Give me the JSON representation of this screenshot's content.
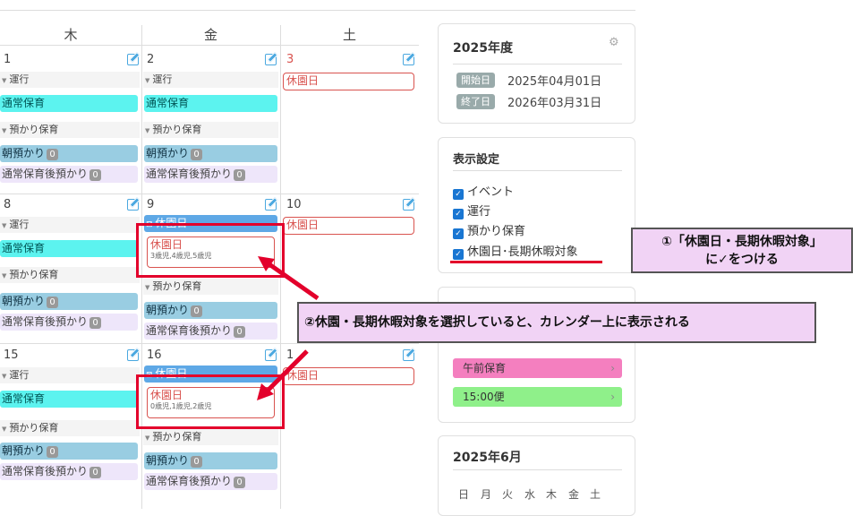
{
  "weekday_headers": [
    "木",
    "金",
    "土"
  ],
  "row1": {
    "thu": {
      "day": "1",
      "sections": {
        "unkou": "運行",
        "azukari": "預かり保育"
      },
      "chips": {
        "tsujo": "通常保育",
        "asa": "朝預かり",
        "asa_count": "0",
        "after": "通常保育後預かり",
        "after_count": "0"
      }
    },
    "fri": {
      "day": "2",
      "sections": {
        "unkou": "運行",
        "azukari": "預かり保育"
      },
      "chips": {
        "tsujo": "通常保育",
        "asa": "朝預かり",
        "asa_count": "0",
        "after": "通常保育後預かり",
        "after_count": "0"
      }
    },
    "sat": {
      "day": "3",
      "holiday": "休園日"
    }
  },
  "row2": {
    "thu": {
      "day": "8",
      "sections": {
        "unkou": "運行",
        "azukari": "預かり保育"
      },
      "chips": {
        "tsujo": "通常保育",
        "asa": "朝預かり",
        "asa_count": "0",
        "after": "通常保育後預かり",
        "after_count": "0"
      }
    },
    "fri": {
      "day": "9",
      "holiday_event": "休園日",
      "holiday": "休園日",
      "holiday_sub": "3歳児,4歳児,5歳児",
      "sections": {
        "azukari": "預かり保育"
      },
      "chips": {
        "asa": "朝預かり",
        "asa_count": "0",
        "after": "通常保育後預かり",
        "after_count": "0"
      }
    },
    "sat": {
      "day": "10",
      "holiday": "休園日"
    }
  },
  "row3": {
    "thu": {
      "day": "15",
      "sections": {
        "unkou": "運行",
        "azukari": "預かり保育"
      },
      "chips": {
        "tsujo": "通常保育",
        "asa": "朝預かり",
        "asa_count": "0",
        "after": "通常保育後預かり",
        "after_count": "0"
      }
    },
    "fri": {
      "day": "16",
      "holiday_event": "休園日",
      "holiday": "休園日",
      "holiday_sub": "0歳児,1歳児,2歳児",
      "sections": {
        "azukari": "預かり保育"
      },
      "chips": {
        "asa": "朝預かり",
        "asa_count": "0",
        "after": "通常保育後預かり",
        "after_count": "0"
      }
    },
    "sat": {
      "day": "1",
      "holiday": "休園日"
    }
  },
  "fiscal": {
    "title": "2025年度",
    "start_label": "開始日",
    "start_date": "2025年04月01日",
    "end_label": "終了日",
    "end_date": "2026年03月31日"
  },
  "display_settings": {
    "title": "表示設定",
    "options": [
      "イベント",
      "運行",
      "預かり保育",
      "休園日･長期休暇対象"
    ]
  },
  "routes": [
    {
      "label": "午前保育",
      "color": "#f47fbf"
    },
    {
      "label": "15:00便",
      "color": "#8ff08a"
    }
  ],
  "mini_calendar": {
    "title": "2025年6月",
    "weekdays": [
      "日",
      "月",
      "火",
      "水",
      "木",
      "金",
      "土"
    ]
  },
  "callouts": {
    "one_line1": "①「休園日・長期休暇対象」",
    "one_line2": "に✓をつける",
    "two": "②休園・長期休暇対象を選択していると、カレンダー上に表示される"
  },
  "colors": {
    "accent_red": "#e3002b",
    "callout_bg": "#f1d3f5",
    "chip_cyan": "#5cf3ef",
    "chip_blue": "#99cde2",
    "checkbox_blue": "#1976d2"
  }
}
